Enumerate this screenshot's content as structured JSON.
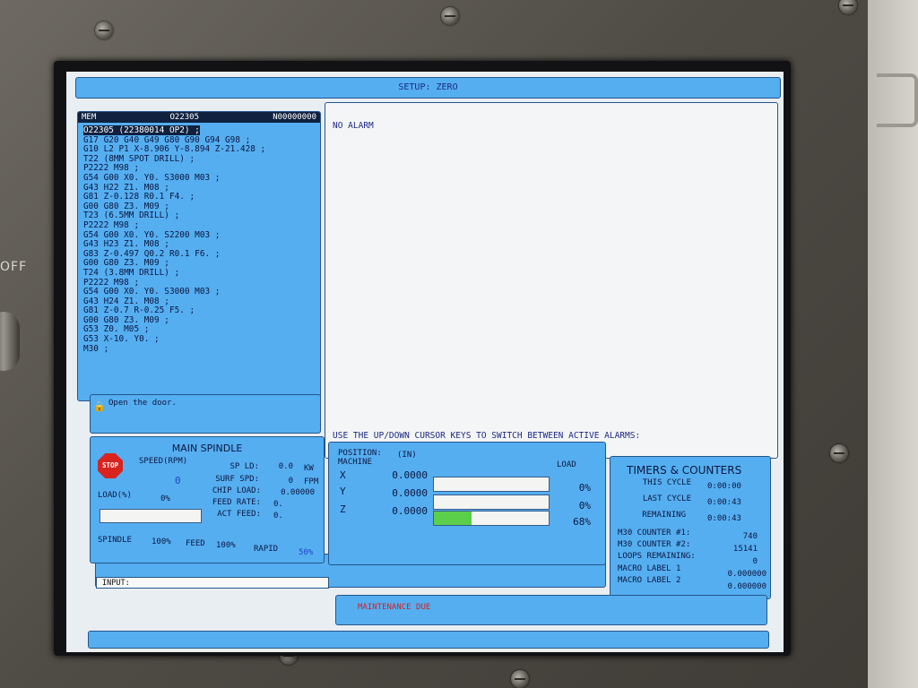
{
  "header": {
    "title": "SETUP: ZERO"
  },
  "program": {
    "mode": "MEM",
    "number": "O22305",
    "sequence": "N00000000",
    "lines": [
      "O22305 (22380014 OP2) ;",
      "G17 G20 G40 G49 G80 G90 G94 G98 ;",
      "G10 L2 P1 X-8.906 Y-8.894 Z-21.428 ;",
      "T22 (8MM SPOT DRILL) ;",
      "P2222 M98 ;",
      "G54 G00 X0. Y0. S3000 M03 ;",
      "G43 H22 Z1. M08 ;",
      "G81 Z-0.128 R0.1 F4. ;",
      "G00 G80 Z3. M09 ;",
      "T23 (6.5MM DRILL) ;",
      "P2222 M98 ;",
      "G54 G00 X0. Y0. S2200 M03 ;",
      "G43 H23 Z1. M08 ;",
      "G83 Z-0.497 Q0.2 R0.1 F6. ;",
      "G00 G80 Z3. M09 ;",
      "T24 (3.8MM DRILL) ;",
      "P2222 M98 ;",
      "G54 G00 X0. Y0. S3000 M03 ;",
      "G43 H24 Z1. M08 ;",
      "G81 Z-0.7 R-0.25 F5. ;",
      "G00 G80 Z3. M09 ;",
      "G53 Z0. M05 ;",
      "G53 X-10. Y0. ;",
      "M30 ;"
    ]
  },
  "door_message": "Open the door.",
  "alarm": {
    "status": "NO ALARM",
    "hint": "USE THE UP/DOWN CURSOR KEYS TO SWITCH BETWEEN ACTIVE ALARMS:"
  },
  "spindle": {
    "title": "MAIN SPINDLE",
    "stop_label": "STOP",
    "speed_label": "SPEED(RPM)",
    "speed_value": "0",
    "load_label": "LOAD(%)",
    "load_value": "0%",
    "sp_ld_label": "SP LD:",
    "sp_ld_value": "0.0",
    "sp_ld_unit": "KW",
    "surf_spd_label": "SURF SPD:",
    "surf_spd_value": "0",
    "surf_spd_unit": "FPM",
    "chip_load_label": "CHIP LOAD:",
    "chip_load_value": "0.00000",
    "feed_rate_label": "FEED RATE:",
    "feed_rate_value": "0.",
    "act_feed_label": "ACT FEED:",
    "act_feed_value": "0.",
    "override_spindle_label": "SPINDLE",
    "override_spindle_value": "100%",
    "override_feed_label": "FEED",
    "override_feed_value": "100%",
    "override_rapid_label": "RAPID",
    "override_rapid_value": "50%"
  },
  "position": {
    "title": "POSITION:",
    "units": "(IN)",
    "subtitle": "MACHINE",
    "load_header": "LOAD",
    "axes": [
      {
        "name": "X",
        "value": "0.0000",
        "load": "0%",
        "load_fraction": 0.0
      },
      {
        "name": "Y",
        "value": "0.0000",
        "load": "0%",
        "load_fraction": 0.0
      },
      {
        "name": "Z",
        "value": "0.0000",
        "load": "68%",
        "load_fraction": 0.33
      }
    ],
    "load_bar_color": "#5bcf4a"
  },
  "timers": {
    "title": "TIMERS & COUNTERS",
    "rows": [
      {
        "label": "THIS CYCLE",
        "value": "0:00:00"
      },
      {
        "label": "LAST CYCLE",
        "value": "0:00:43"
      },
      {
        "label": "REMAINING",
        "value": "0:00:43"
      }
    ],
    "counters": [
      {
        "label": "M30 COUNTER #1:",
        "value": "740"
      },
      {
        "label": "M30 COUNTER #2:",
        "value": "15141"
      },
      {
        "label": "LOOPS REMAINING:",
        "value": "0"
      },
      {
        "label": "MACRO LABEL 1",
        "value": "0.000000"
      },
      {
        "label": "MACRO LABEL 2",
        "value": "0.000000"
      }
    ]
  },
  "input": {
    "label": "INPUT:"
  },
  "maintenance": {
    "text": "MAINTENANCE DUE"
  },
  "bezel": {
    "off_label": "OFF"
  }
}
